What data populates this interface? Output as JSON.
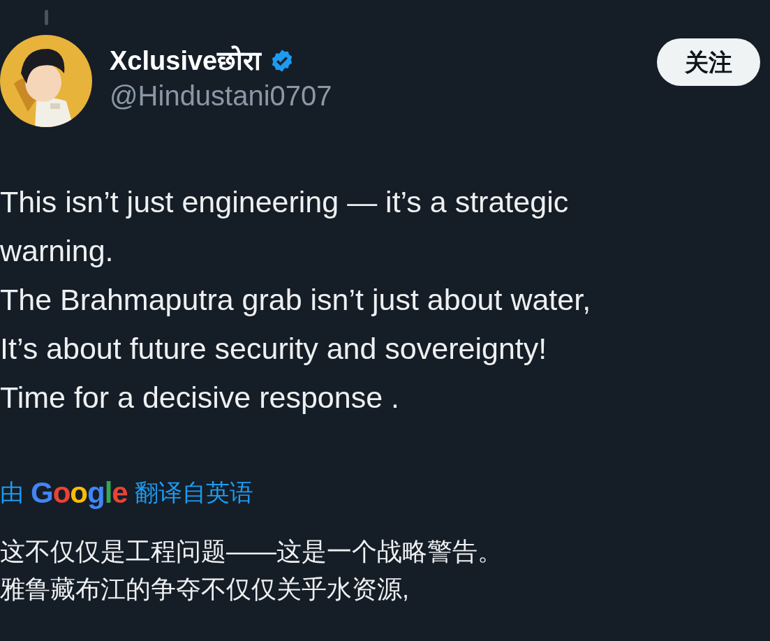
{
  "author": {
    "name": "Xclusiveछोरा",
    "verified": true,
    "handle": "@Hindustani0707"
  },
  "follow_button": {
    "label": "关注"
  },
  "tweet_lines": [
    "This isn’t just engineering — it’s a strategic",
    "warning.",
    "The Brahmaputra grab isn’t just about water,",
    "It’s about future security and sovereignty!",
    "Time for a decisive response ."
  ],
  "translation": {
    "prefix": "由",
    "logo": "Google",
    "suffix": "翻译自英语"
  },
  "translated_lines": [
    "这不仅仅是工程问题——这是一个战略警告。",
    "雅鲁藏布江的争夺不仅仅关乎水资源,"
  ]
}
